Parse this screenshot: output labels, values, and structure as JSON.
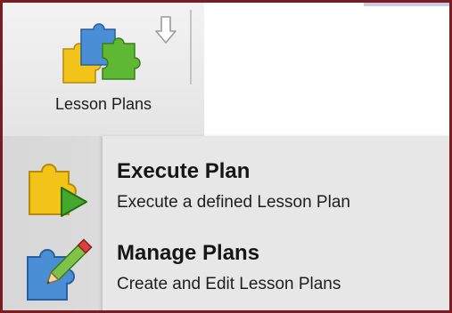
{
  "toolbar": {
    "button_label": "Lesson Plans",
    "icon": "puzzle-pieces-icon",
    "dropdown_icon": "arrow-down-icon"
  },
  "menu": {
    "items": [
      {
        "title": "Execute Plan",
        "description": "Execute a defined Lesson Plan",
        "icon": "puzzle-play-icon"
      },
      {
        "title": "Manage Plans",
        "description": "Create and Edit Lesson Plans",
        "icon": "puzzle-edit-icon"
      }
    ]
  },
  "colors": {
    "frame_border": "#7a1c22",
    "puzzle_yellow": "#f2c319",
    "puzzle_green": "#5fb833",
    "puzzle_blue": "#4a8fd6",
    "play_green": "#43a82b",
    "pencil_red": "#d94040"
  }
}
